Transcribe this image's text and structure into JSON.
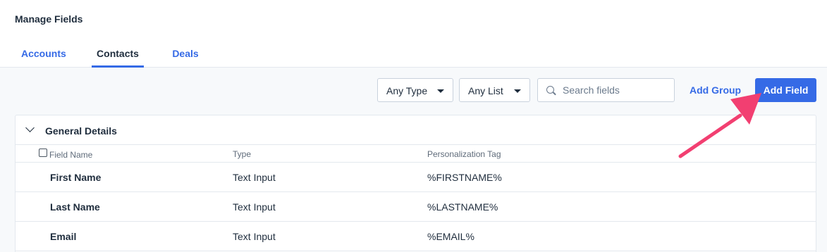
{
  "page": {
    "title": "Manage Fields"
  },
  "tabs": [
    {
      "label": "Accounts",
      "active": false
    },
    {
      "label": "Contacts",
      "active": true
    },
    {
      "label": "Deals",
      "active": false
    }
  ],
  "toolbar": {
    "type_filter": "Any Type",
    "list_filter": "Any List",
    "search_placeholder": "Search fields",
    "add_group_label": "Add Group",
    "add_field_label": "Add Field"
  },
  "group": {
    "title": "General Details",
    "columns": {
      "name": "Field Name",
      "type": "Type",
      "tag": "Personalization Tag"
    },
    "rows": [
      {
        "name": "First Name",
        "type": "Text Input",
        "tag": "%FIRSTNAME%"
      },
      {
        "name": "Last Name",
        "type": "Text Input",
        "tag": "%LASTNAME%"
      },
      {
        "name": "Email",
        "type": "Text Input",
        "tag": "%EMAIL%"
      }
    ]
  },
  "colors": {
    "accent": "#356ae6",
    "annotation_arrow": "#f23f71",
    "background": "#f7f9fb"
  }
}
